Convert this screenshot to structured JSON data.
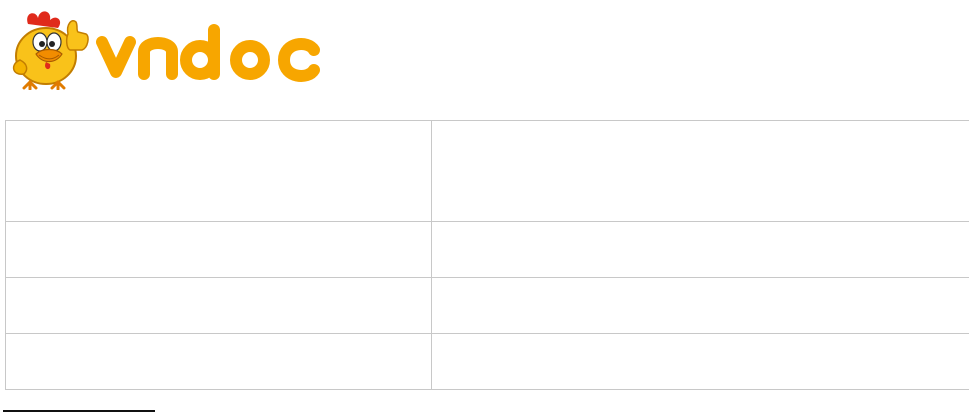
{
  "logo": {
    "brand_text": "vndoc",
    "mascot_icon": "chicken-mascot-thumbs-up",
    "brand_color": "#f7a600"
  },
  "table": {
    "rows": [
      [
        "",
        ""
      ],
      [
        "",
        ""
      ],
      [
        "",
        ""
      ],
      [
        "",
        ""
      ]
    ]
  }
}
